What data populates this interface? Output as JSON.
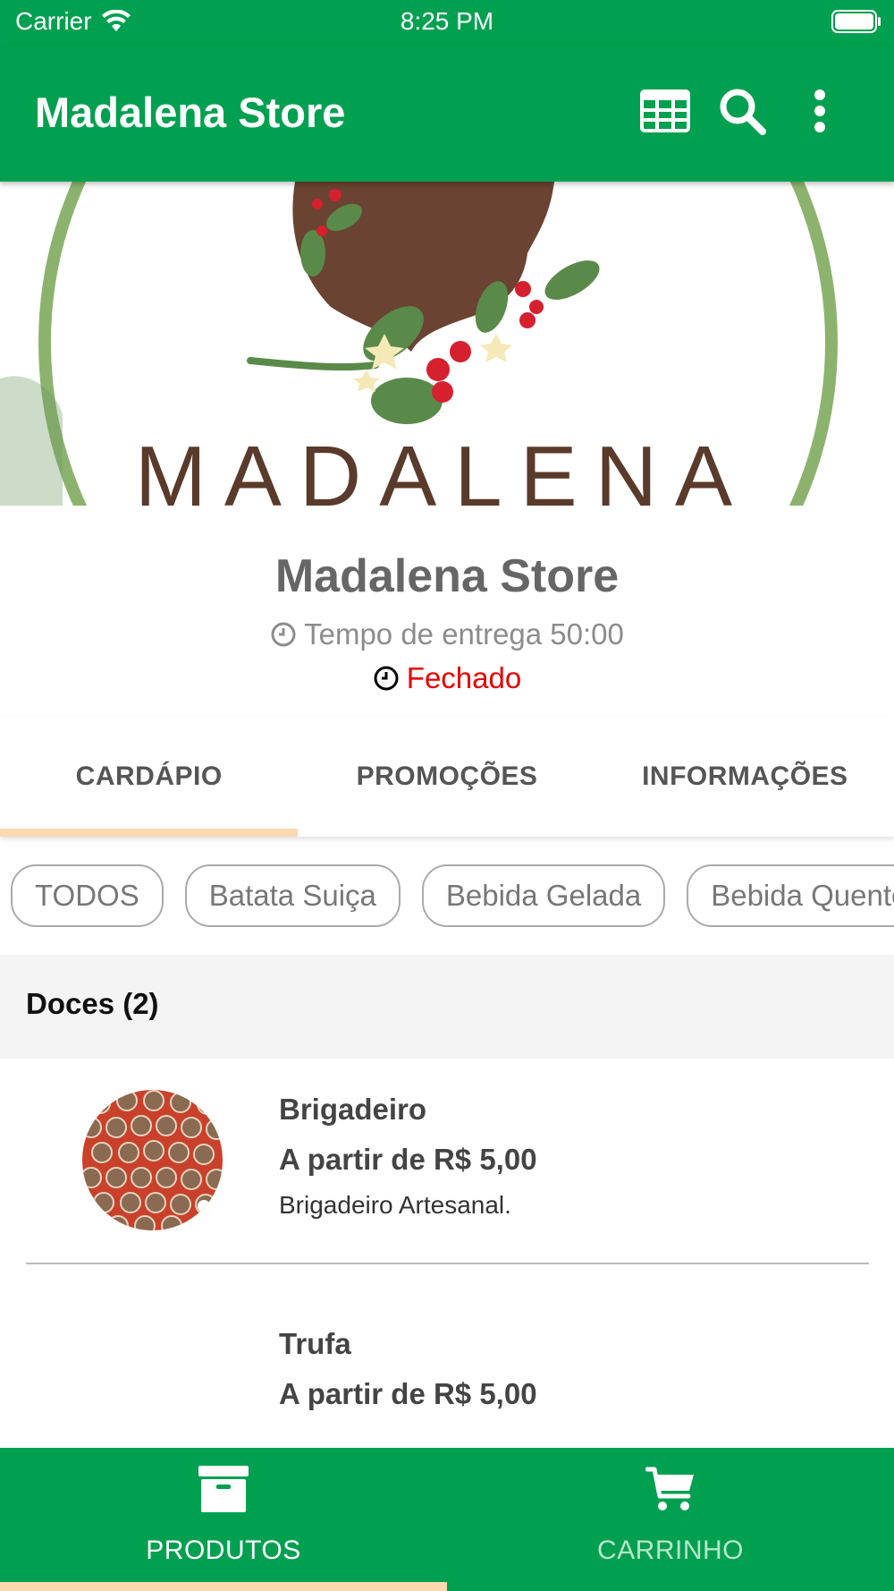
{
  "status_bar": {
    "carrier": "Carrier",
    "time": "8:25 PM"
  },
  "app_bar": {
    "title": "Madalena Store",
    "icons": [
      "table-grid-icon",
      "search-icon",
      "more-vertical-icon"
    ]
  },
  "banner": {
    "logo_text": "MADALENA"
  },
  "store": {
    "name": "Madalena Store",
    "delivery_time": "Tempo de entrega 50:00",
    "status": "Fechado"
  },
  "tabs": [
    {
      "label": "CARDÁPIO",
      "active": true
    },
    {
      "label": "PROMOÇÕES",
      "active": false
    },
    {
      "label": "INFORMAÇÕES",
      "active": false
    }
  ],
  "categories": [
    "TODOS",
    "Batata Suiça",
    "Bebida Gelada",
    "Bebida Quente"
  ],
  "section": {
    "title": "Doces (2)"
  },
  "products": [
    {
      "name": "Brigadeiro",
      "price": "A partir de R$ 5,00",
      "description": "Brigadeiro Artesanal."
    },
    {
      "name": "Trufa",
      "price": "A partir de R$ 5,00",
      "description": ""
    }
  ],
  "bottom_nav": {
    "items": [
      {
        "label": "PRODUTOS",
        "icon": "archive-box-icon",
        "active": true
      },
      {
        "label": "CARRINHO",
        "icon": "cart-icon",
        "active": false
      }
    ]
  },
  "colors": {
    "primary": "#00a050",
    "accent_indicator": "#fbd9ae",
    "closed_red": "#e60000"
  }
}
